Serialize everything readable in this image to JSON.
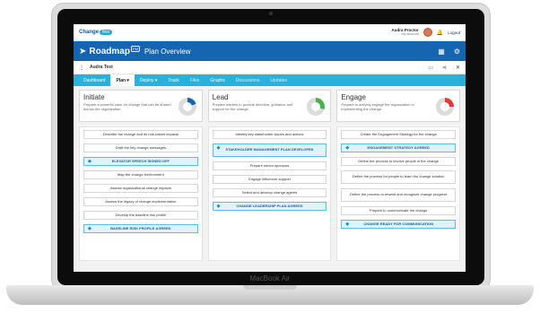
{
  "laptop": {
    "brand": "MacBook Air"
  },
  "header": {
    "logo_text": "Change",
    "logo_badge": "first",
    "user_name": "Audra Proctor",
    "user_link": "My account",
    "logout_label": "Logout",
    "bell_icon": "bell-icon"
  },
  "title_bar": {
    "app_name": "Roadmap",
    "badge": "PM",
    "page_title": "Plan Overview"
  },
  "sub_bar": {
    "title": "Audra Test"
  },
  "tabs": [
    {
      "label": "Dashboard"
    },
    {
      "label": "Plan ▾"
    },
    {
      "label": "Deploy ▾"
    },
    {
      "label": "Track"
    },
    {
      "label": "Files"
    },
    {
      "label": "Graphs"
    },
    {
      "label": "Discussions"
    },
    {
      "label": "Updates"
    }
  ],
  "columns": [
    {
      "title": "Initiate",
      "description": "Prepare a powerful case for change that can be shared across the organization.",
      "donut_color": "#1565b0",
      "donut_fraction": 0.2,
      "tasks": [
        {
          "label": "Describe the change and its role-based impacts"
        },
        {
          "label": "Draft the key change messages"
        },
        {
          "label": "ELEVATOR SPEECH SIGNED OFF"
        },
        {
          "label": "Map the change environment"
        },
        {
          "label": "Assess organizational change impacts"
        },
        {
          "label": "Assess the legacy of change implementation"
        },
        {
          "label": "Develop the baseline risk profile"
        },
        {
          "label": "BASELINE RISK PROFILE AGREED"
        }
      ]
    },
    {
      "title": "Lead",
      "description": "Prepare leaders to provide direction, guidance and support for the change.",
      "donut_color": "#4caf50",
      "donut_fraction": 0.3,
      "tasks": [
        {
          "label": "Identify key stakeholder issues and actions"
        },
        {
          "label": "STAKEHOLDER MANAGEMENT PLAN DEVELOPED"
        },
        {
          "label": "Prepare senior sponsors"
        },
        {
          "label": "Engage influencer support"
        },
        {
          "label": "Select and develop change agents"
        },
        {
          "label": "CHANGE LEADERSHIP PLAN AGREED"
        }
      ]
    },
    {
      "title": "Engage",
      "description": "Prepare to actively engage the organization in implementing the change.",
      "donut_color": "#e53935",
      "donut_fraction": 0.25,
      "tasks": [
        {
          "label": "Create the Engagement Strategy for the change"
        },
        {
          "label": "ENGAGEMENT STRATEGY AGREED"
        },
        {
          "label": "Define the process to involve people in the change"
        },
        {
          "label": "Define the process for people to learn the change solution"
        },
        {
          "label": "Define the process to reward and recognize change progress"
        },
        {
          "label": "Prepare to communicate the change"
        },
        {
          "label": "CHANGE READY FOR COMMUNICATION"
        }
      ]
    }
  ]
}
